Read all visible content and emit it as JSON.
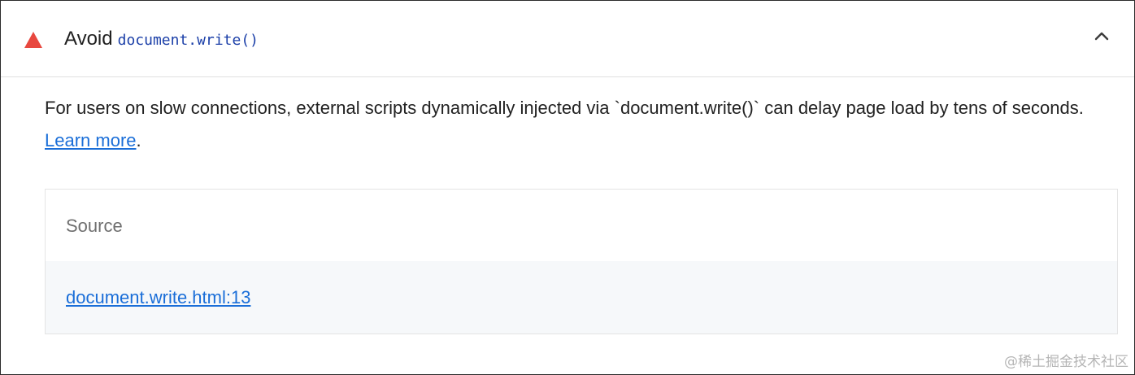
{
  "audit": {
    "status": "fail",
    "status_color": "#e8483f",
    "status_icon": "warning-triangle-icon",
    "title_prefix": "Avoid",
    "title_code": "document.write()",
    "expand_icon": "chevron-up-icon",
    "expanded": true
  },
  "description": {
    "text": "For users on slow connections, external scripts dynamically injected via `document.write()` can delay page load by tens of seconds.",
    "link_text": "Learn more",
    "suffix": "."
  },
  "table": {
    "column_header": "Source",
    "rows": [
      {
        "source": "document.write.html:13"
      }
    ]
  },
  "watermark": "@稀土掘金技术社区",
  "colors": {
    "link": "#1a6ed8",
    "code": "#1b3fa8",
    "row_background": "#f6f8fa"
  }
}
